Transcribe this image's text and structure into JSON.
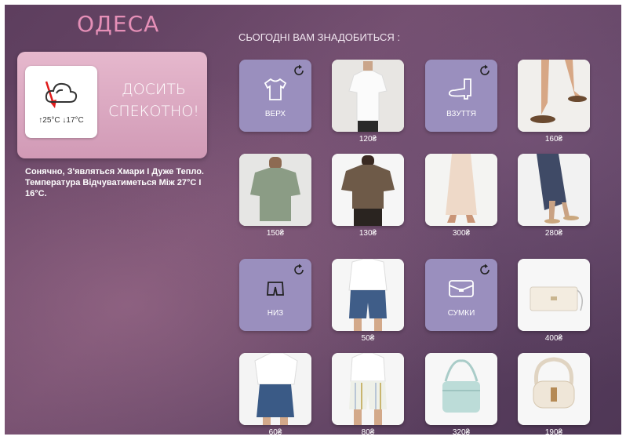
{
  "city": "ОДЕСА",
  "weather": {
    "temps": "↑25°C ↓17°C",
    "title_line1": "ДОСИТЬ",
    "title_line2": "СПЕКОТНО!",
    "icon": "cloud-icon"
  },
  "description": "Сонячно, З'являться Хмари І Дуже Тепло. Температура Відчуватиметься Між 27°C І 16°C.",
  "heading": "СЬОГОДНІ ВАМ ЗНАДОБИТЬСЯ :",
  "categories": {
    "top": "ВЕРХ",
    "shoes": "ВЗУТТЯ",
    "bottom": "НИЗ",
    "bags": "СУМКИ"
  },
  "prices": [
    "120₴",
    "160₴",
    "150₴",
    "130₴",
    "300₴",
    "280₴",
    "50₴",
    "400₴",
    "60₴",
    "80₴",
    "320₴",
    "190₴"
  ],
  "colors": {
    "category_tile": "#9a8fbe",
    "city_text": "#e58fb7",
    "weather_card": "#d9a6bf"
  }
}
